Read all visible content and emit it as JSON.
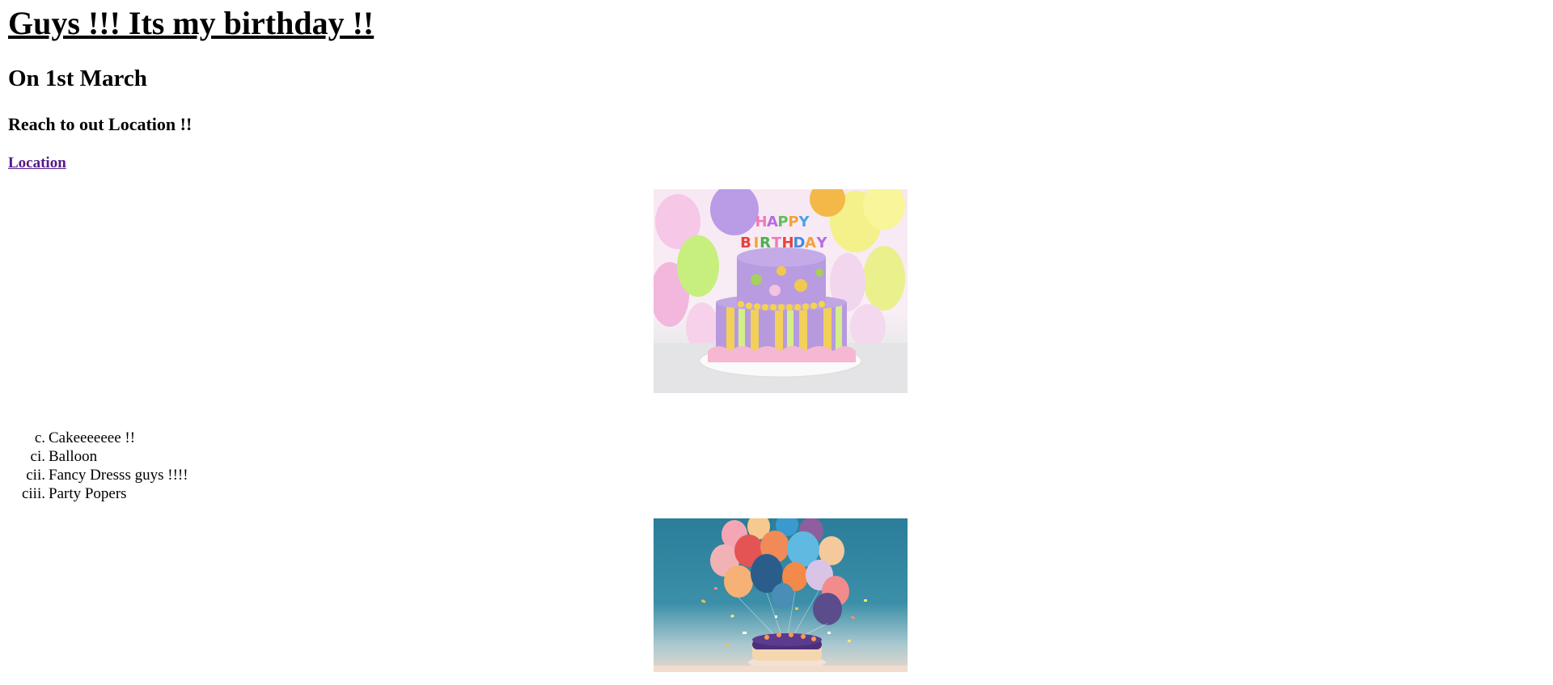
{
  "heading": "Guys !!! Its my birthday !!",
  "date": "On 1st March",
  "reach": "Reach to out Location !!",
  "location_link": "Location",
  "images": {
    "cake_candle_letters": "HAPPY BIRTHDAY"
  },
  "list": {
    "items": [
      {
        "num": "c.",
        "label": "Cakeeeeeee !!"
      },
      {
        "num": "ci.",
        "label": "Balloon"
      },
      {
        "num": "cii.",
        "label": "Fancy Dresss guys !!!!"
      },
      {
        "num": "ciii.",
        "label": "Party Popers"
      }
    ]
  },
  "colors": {
    "link_visited": "#551a8b",
    "text": "#000000",
    "background": "#ffffff"
  }
}
